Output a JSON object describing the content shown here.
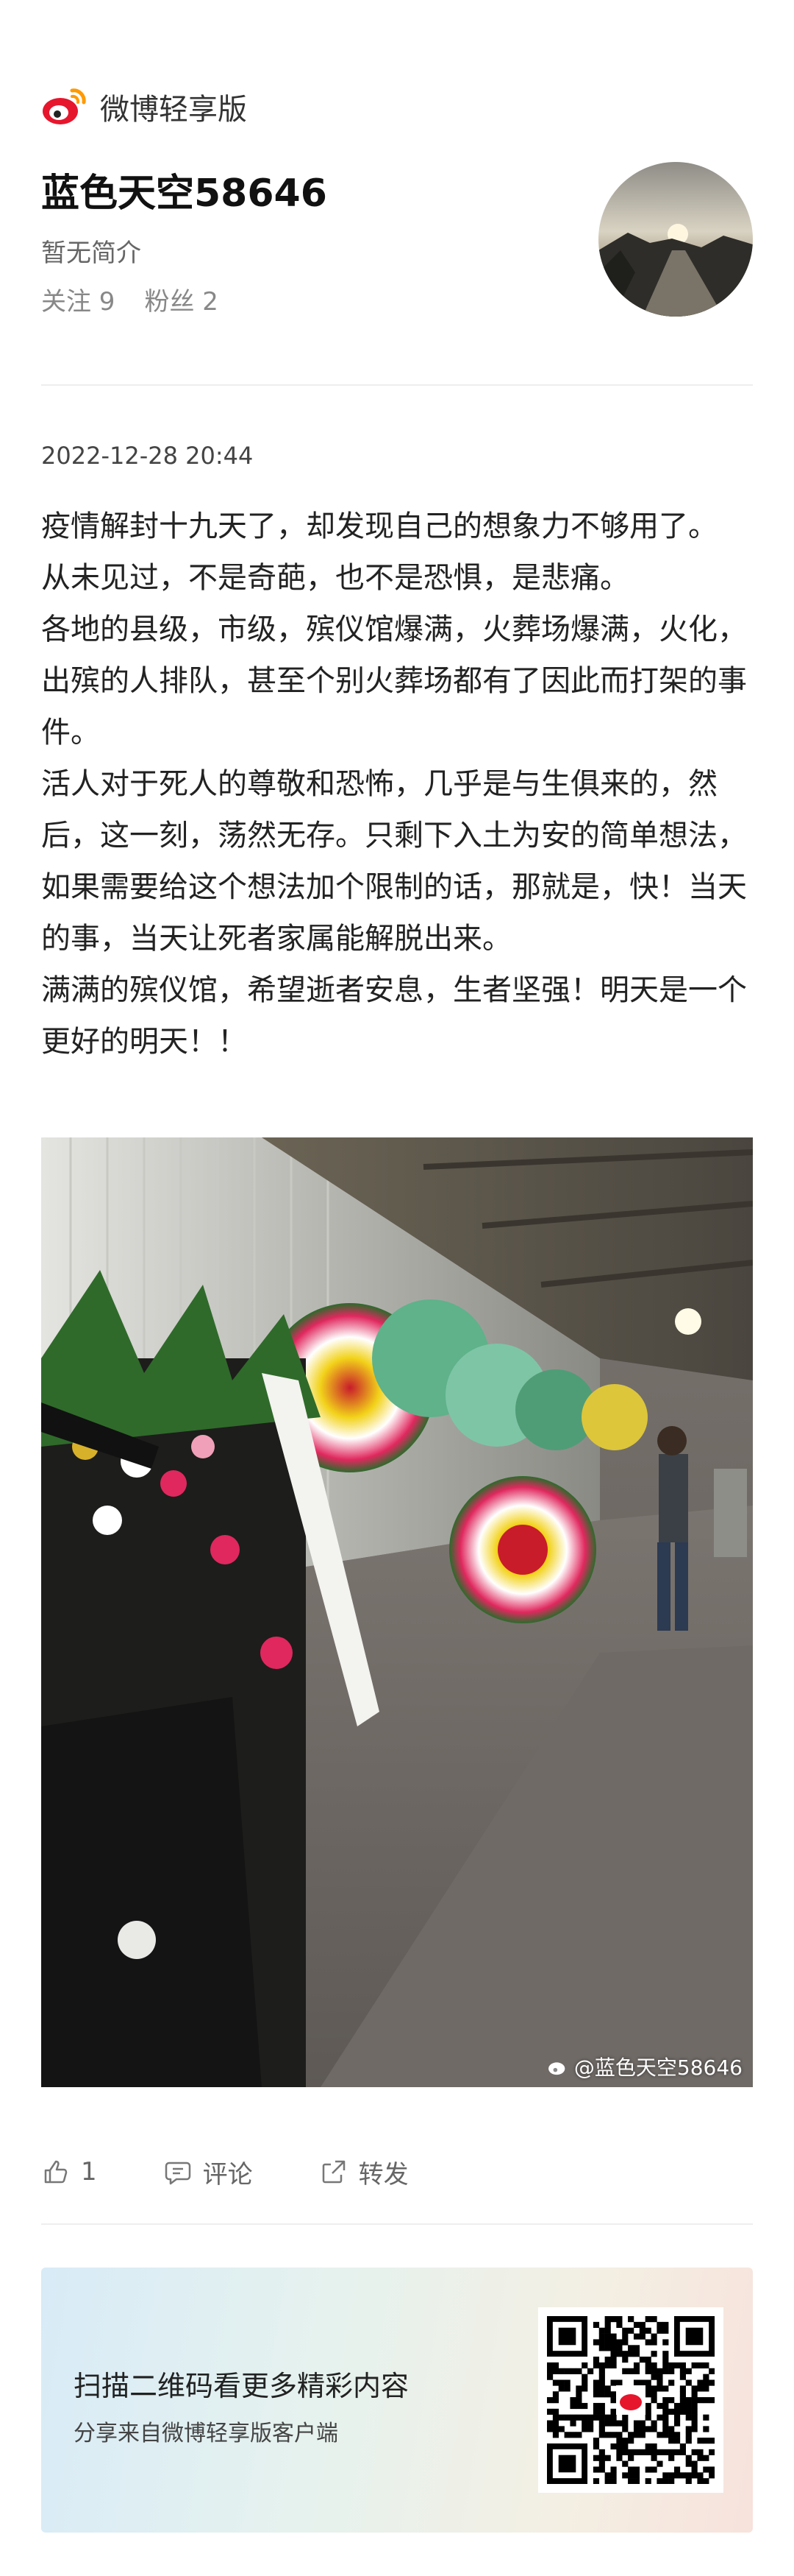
{
  "app": {
    "name": "微博轻享版"
  },
  "profile": {
    "username": "蓝色天空58646",
    "bio": "暂无简介",
    "following_label": "关注 9",
    "followers_label": "粉丝 2"
  },
  "post": {
    "time": "2022-12-28 20:44",
    "paragraphs": [
      "疫情解封十九天了，却发现自己的想象力不够用了。",
      "从未见过，不是奇葩，也不是恐惧，是悲痛。",
      "各地的县级，市级，殡仪馆爆满，火葬场爆满，火化，出殡的人排队，甚至个别火葬场都有了因此而打架的事件。",
      "活人对于死人的尊敬和恐怖，几乎是与生俱来的，然后，这一刻，荡然无存。只剩下入土为安的简单想法，如果需要给这个想法加个限制的话，那就是，快！当天的事，当天让死者家属能解脱出来。",
      "满满的殡仪馆，希望逝者安息，生者坚强！明天是一个更好的明天！！"
    ],
    "image_watermark": "@蓝色天空58646"
  },
  "actions": {
    "like_count": "1",
    "comment_label": "评论",
    "share_label": "转发"
  },
  "qr_card": {
    "title": "扫描二维码看更多精彩内容",
    "subtitle": "分享来自微博轻享版客户端"
  },
  "icons": [
    "weibo-logo-icon",
    "thumbs-up-icon",
    "comment-icon",
    "share-icon",
    "qr-code-icon"
  ],
  "colors": {
    "weibo_red": "#e6162d",
    "weibo_yellow": "#ff9a00"
  }
}
